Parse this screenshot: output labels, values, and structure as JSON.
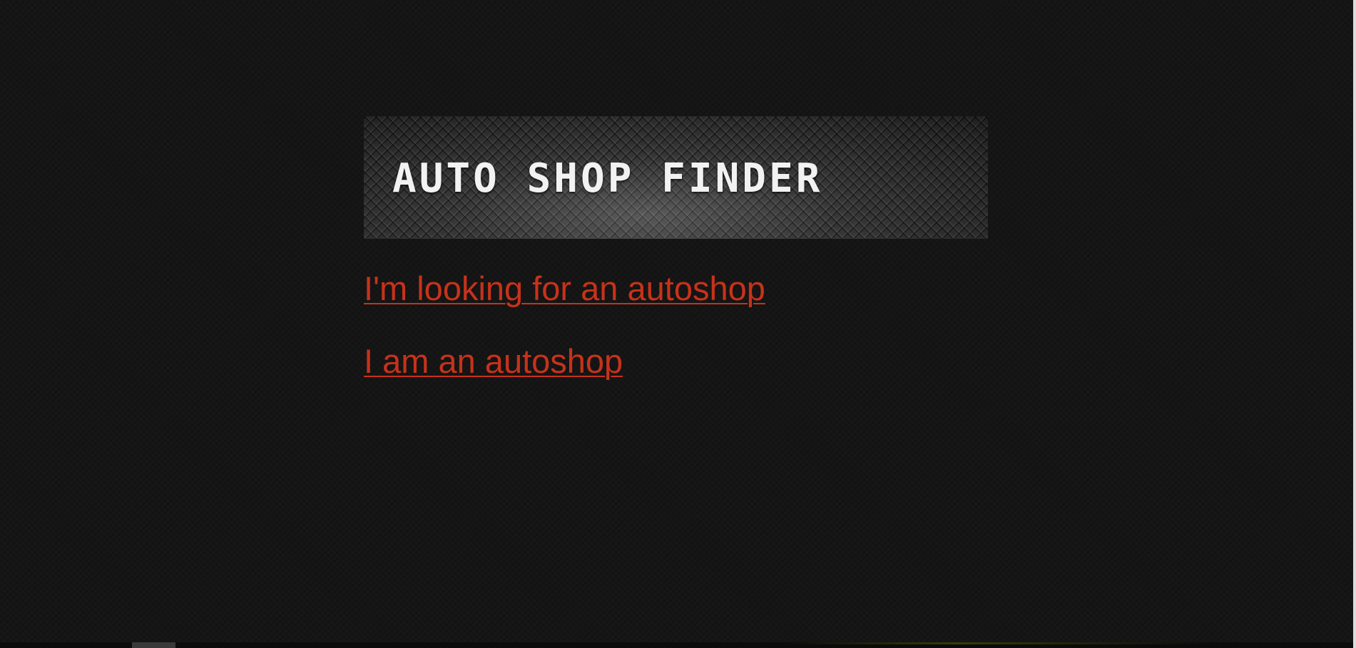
{
  "page": {
    "background_color": "#151515",
    "accent_color": "#c7321a"
  },
  "banner": {
    "title": "Auto Shop Finder"
  },
  "links": [
    {
      "label": "I'm looking for an autoshop"
    },
    {
      "label": "I am an autoshop"
    }
  ]
}
